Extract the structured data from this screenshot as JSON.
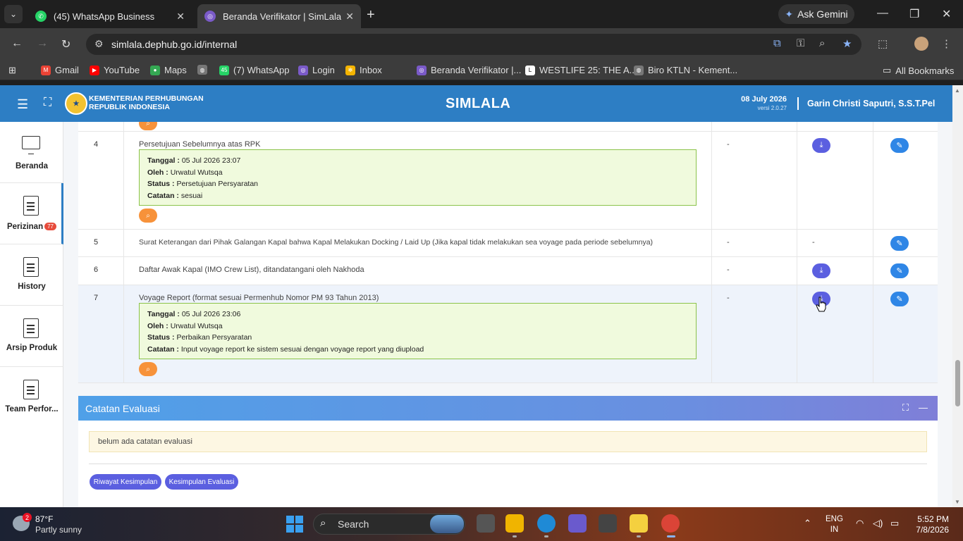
{
  "browser": {
    "tabs": [
      {
        "title": "(45) WhatsApp Business",
        "active": false
      },
      {
        "title": "Beranda Verifikator | SimLala",
        "active": true
      }
    ],
    "gemini_label": "Ask Gemini",
    "url": "simlala.dephub.go.id/internal",
    "bookmarks": [
      {
        "label": "Gmail"
      },
      {
        "label": "YouTube"
      },
      {
        "label": "Maps"
      },
      {
        "label": "(7) WhatsApp"
      },
      {
        "label": "Login"
      },
      {
        "label": "Inbox"
      },
      {
        "label": "Beranda Verifikator |..."
      },
      {
        "label": "WESTLIFE 25: THE A..."
      },
      {
        "label": "Biro KTLN - Kement..."
      }
    ],
    "all_bookmarks": "All Bookmarks"
  },
  "header": {
    "org_line1": "KEMENTERIAN PERHUBUNGAN",
    "org_line2": "REPUBLIK INDONESIA",
    "app_name": "SIMLALA",
    "date": "08 July 2026",
    "version": "versi 2.0.27",
    "user": "Garin Christi Saputri, S.S.T.Pel"
  },
  "sidebar": {
    "items": [
      {
        "label": "Beranda"
      },
      {
        "label": "Perizinan",
        "badge": "77"
      },
      {
        "label": "History"
      },
      {
        "label": "Arsip Produk"
      },
      {
        "label": "Team Perfor..."
      }
    ]
  },
  "table": {
    "rows": [
      {
        "no": "4",
        "name": "Persetujuan Sebelumnya atas RPK",
        "col3": "-",
        "info": {
          "tanggal_label": "Tanggal :",
          "tanggal": "05 Jul 2026 23:07",
          "oleh_label": "Oleh :",
          "oleh": "Urwatul Wutsqa",
          "status_label": "Status :",
          "status": "Persetujuan Persyaratan",
          "catatan_label": "Catatan :",
          "catatan": "sesuai"
        }
      },
      {
        "no": "5",
        "name": "Surat Keterangan dari Pihak Galangan Kapal bahwa Kapal Melakukan Docking / Laid Up (Jika kapal tidak melakukan sea voyage pada periode sebelumnya)",
        "col3": "-",
        "col4": "-"
      },
      {
        "no": "6",
        "name": "Daftar Awak Kapal (IMO Crew List), ditandatangani oleh Nakhoda",
        "col3": "-"
      },
      {
        "no": "7",
        "name": "Voyage Report (format sesuai Permenhub Nomor PM 93 Tahun 2013)",
        "col3": "-",
        "info": {
          "tanggal_label": "Tanggal :",
          "tanggal": "05 Jul 2026 23:06",
          "oleh_label": "Oleh :",
          "oleh": "Urwatul Wutsqa",
          "status_label": "Status :",
          "status": "Perbaikan Persyaratan",
          "catatan_label": "Catatan :",
          "catatan": "Input voyage report ke sistem sesuai dengan voyage report yang diupload"
        }
      }
    ]
  },
  "evaluation": {
    "title": "Catatan Evaluasi",
    "note": "belum ada catatan evaluasi",
    "btn_riwayat": "Riwayat Kesimpulan",
    "btn_kesimpulan": "Kesimpulan Evaluasi"
  },
  "taskbar": {
    "weather_badge": "2",
    "temp": "87°F",
    "condition": "Partly sunny",
    "search": "Search",
    "lang1": "ENG",
    "lang2": "IN",
    "time": "5:52 PM",
    "date": "7/8/2026"
  },
  "colors": {
    "header_blue": "#2d7ec4",
    "download_btn": "#5b5fe0",
    "edit_btn": "#2f86e6",
    "info_bg": "#f0fadd",
    "zoom_btn": "#f7923a"
  }
}
